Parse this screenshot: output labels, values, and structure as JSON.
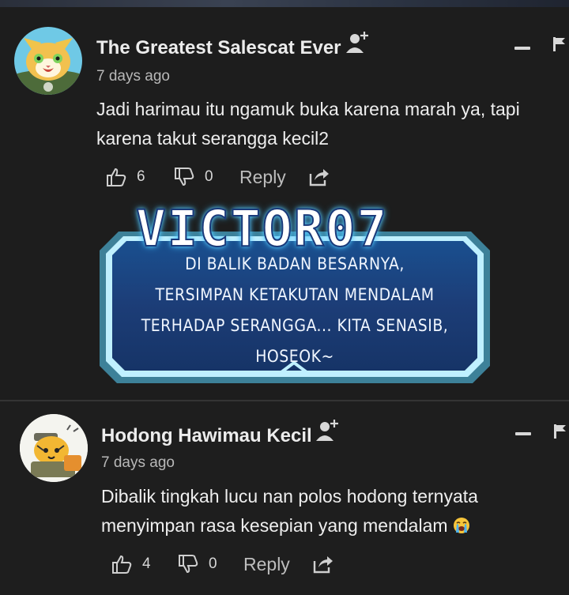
{
  "comments": [
    {
      "author": "The Greatest Salescat Ever",
      "date": "7 days ago",
      "text": "Jadi harimau itu ngamuk buka karena marah ya, tapi karena takut serangga kecil2",
      "likes": "6",
      "dislikes": "0",
      "reply_label": "Reply",
      "avatar": "cat-avatar-icon",
      "attachment": {
        "title": "VICTOR07",
        "lines": [
          "DI BALIK BADAN BESARNYA,",
          "TERSIMPAN KETAKUTAN MENDALAM",
          "TERHADAP SERANGGA... KITA SENASIB,",
          "HOSEOK~"
        ]
      }
    },
    {
      "author": "Hodong Hawimau Kecil",
      "date": "7 days ago",
      "text": "Dibalik tingkah lucu nan polos hodong ternyata menyimpan rasa kesepian yang mendalam",
      "emoji": "crying-face-icon",
      "likes": "4",
      "dislikes": "0",
      "reply_label": "Reply",
      "avatar": "tiger-avatar-icon"
    }
  ],
  "colors": {
    "background": "#1d1d1d",
    "text": "#eeeeee",
    "meta": "#b8b8b8",
    "panel_glow": "#4fc3ff"
  }
}
